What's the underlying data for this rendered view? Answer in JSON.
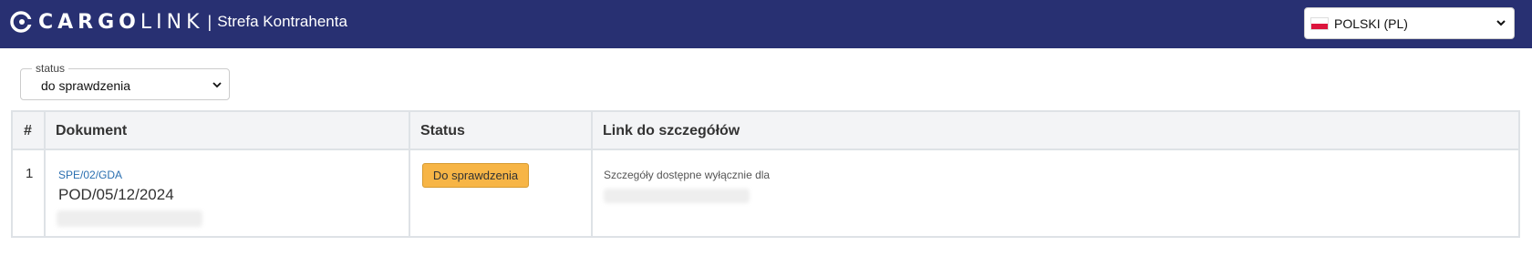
{
  "header": {
    "logo_cargo": "CARGO",
    "logo_link": "LINK",
    "separator": "|",
    "subtitle": "Strefa Kontrahenta",
    "language_selected": "POLSKI (PL)",
    "background_color": "#283072"
  },
  "filter": {
    "legend": "status",
    "selected": "do sprawdzenia"
  },
  "table": {
    "columns": [
      "#",
      "Dokument",
      "Status",
      "Link do szczegółów"
    ],
    "rows": [
      {
        "index": "1",
        "doc_link": "SPE/02/GDA",
        "doc_number": "POD/05/12/2024",
        "status": "Do sprawdzenia",
        "status_color": "#f7b546",
        "link_text": "Szczegóły dostępne wyłącznie dla"
      }
    ]
  },
  "icons": {
    "logo": "cargolink-logo-icon",
    "flag": "poland-flag-icon",
    "dropdown": "chevron-down-icon"
  }
}
